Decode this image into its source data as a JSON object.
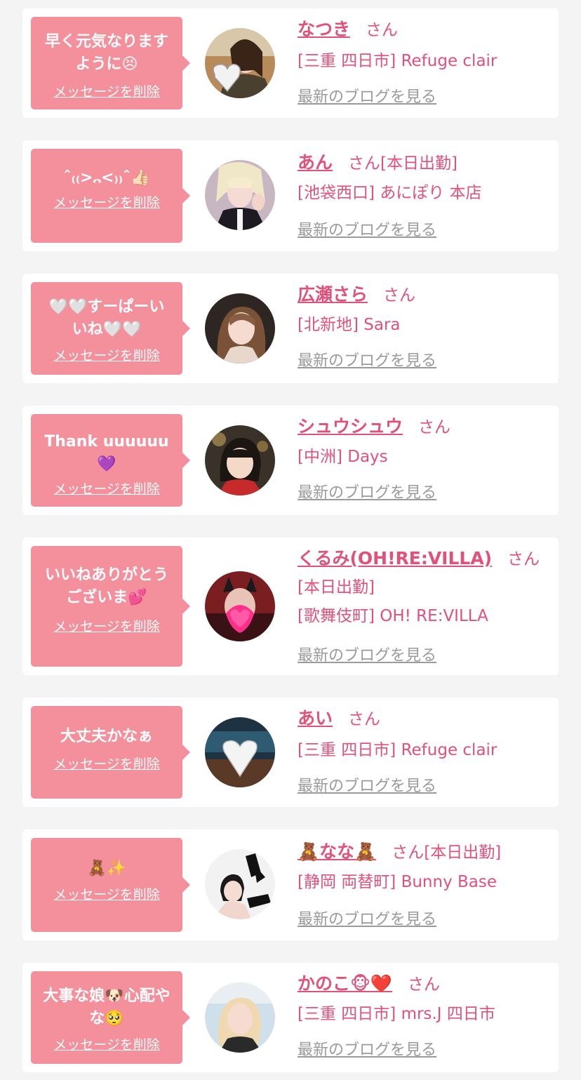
{
  "colors": {
    "background": "#f4f4f4",
    "card": "#ffffff",
    "bubble": "#f4909c",
    "accent_text": "#e0527a",
    "blog_link": "#9a9a9a"
  },
  "delete_label": "メッセージを削除",
  "blog_label": "最新のブログを見る",
  "san_label": "さん",
  "items": [
    {
      "message": "早く元気なります\nように😣",
      "name": "なつき",
      "status": "",
      "shop": "[三重 四日市] Refuge clair"
    },
    {
      "message": "ˆ₍₍>᎔<₎₎ˆ👍🏻",
      "name": "あん",
      "status": "[本日出勤]",
      "shop": "[池袋西口] あにぽり 本店"
    },
    {
      "message": "🤍🤍すーぱーい\nいね🤍🤍",
      "name": "広瀬さら",
      "status": "",
      "shop": "[北新地] Sara"
    },
    {
      "message": "Thank uuuuuu💜",
      "name": "シュウシュウ",
      "status": "",
      "shop": "[中洲] Days"
    },
    {
      "message": "いいねありがとう\nございま💕",
      "name": "くるみ(OH!RE:VILLA)",
      "status": "",
      "status_line": "[本日出勤]",
      "shop": "[歌舞伎町] OH! RE:VILLA"
    },
    {
      "message": "大丈夫かなぁ",
      "name": "あい",
      "status": "",
      "shop": "[三重 四日市] Refuge clair"
    },
    {
      "message": "🧸✨",
      "name": "🧸なな🧸",
      "status": "[本日出勤]",
      "shop": "[静岡 両替町] Bunny Base"
    },
    {
      "message": "大事な娘🐶心配や\nな🥺",
      "name": "かのこ🐵❤️",
      "status": "",
      "shop": "[三重 四日市] mrs.J 四日市"
    }
  ]
}
